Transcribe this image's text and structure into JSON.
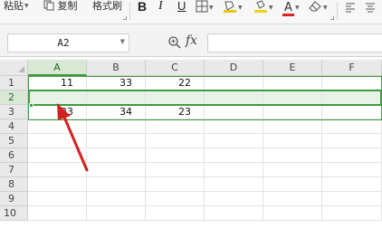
{
  "ribbon": {
    "paste_label": "粘贴",
    "copy_label": "复制",
    "format_painter_label": "格式刷",
    "bold_glyph": "B",
    "italic_glyph": "I",
    "underline_glyph": "U",
    "font_color_glyph": "A"
  },
  "formula_bar": {
    "name_box_value": "A2",
    "fx_label": "fx",
    "formula_value": ""
  },
  "grid": {
    "columns": [
      "A",
      "B",
      "C",
      "D",
      "E",
      "F"
    ],
    "rows": [
      "1",
      "2",
      "3",
      "4",
      "5",
      "6",
      "7",
      "8",
      "9",
      "10"
    ],
    "selected_cell": "A2",
    "cells": {
      "A1": "11",
      "B1": "33",
      "C1": "22",
      "A3": "23",
      "B3": "34",
      "C3": "23"
    }
  },
  "colors": {
    "selection": "#3f9b3f",
    "annotation_arrow": "#d22020",
    "highlight_fill": "#e8f2e6"
  },
  "icons": [
    "paste-icon",
    "copy-icon",
    "format-painter-icon",
    "border-icon",
    "fill-color-icon",
    "font-color-icon",
    "eraser-icon",
    "align-left-icon",
    "align-center-icon",
    "zoom-icon"
  ]
}
